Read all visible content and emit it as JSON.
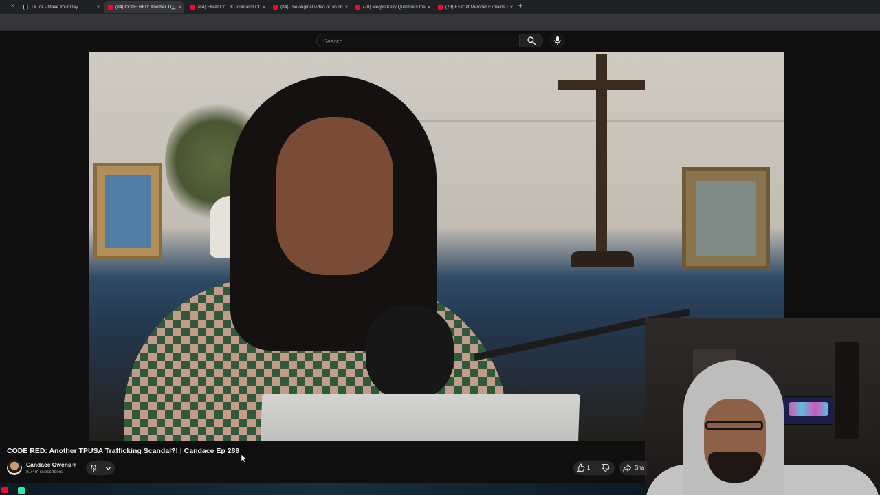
{
  "browser": {
    "tabs": [
      {
        "title": "TikTok - Make Your Day",
        "favicon": "tiktok-icon",
        "active": false
      },
      {
        "title": "(84) CODE RED: Another TP",
        "favicon": "youtube-icon",
        "active": true
      },
      {
        "title": "(84) FINALLY: UK Journalist CO",
        "favicon": "youtube-icon",
        "active": false
      },
      {
        "title": "(84) The original video of Jin sh",
        "favicon": "youtube-icon",
        "active": false
      },
      {
        "title": "(78) Megyn Kelly Questions the",
        "favicon": "youtube-icon",
        "active": false
      },
      {
        "title": "(78) Ex-Cult Member Explains H",
        "favicon": "youtube-icon",
        "active": false
      }
    ],
    "new_tab": "+",
    "close_glyph": "×"
  },
  "masthead": {
    "search_placeholder": "Search"
  },
  "video": {
    "title": "CODE RED: Another TPUSA Trafficking Scandal?! | Candace Ep 289",
    "channel": "Candace Owens",
    "subscribers": "8.74m subscribers",
    "likes": "1",
    "share_label": "Share"
  },
  "colors": {
    "background": "#0f0f0f",
    "youtube_red": "#ff0033",
    "chip": "#272727"
  }
}
